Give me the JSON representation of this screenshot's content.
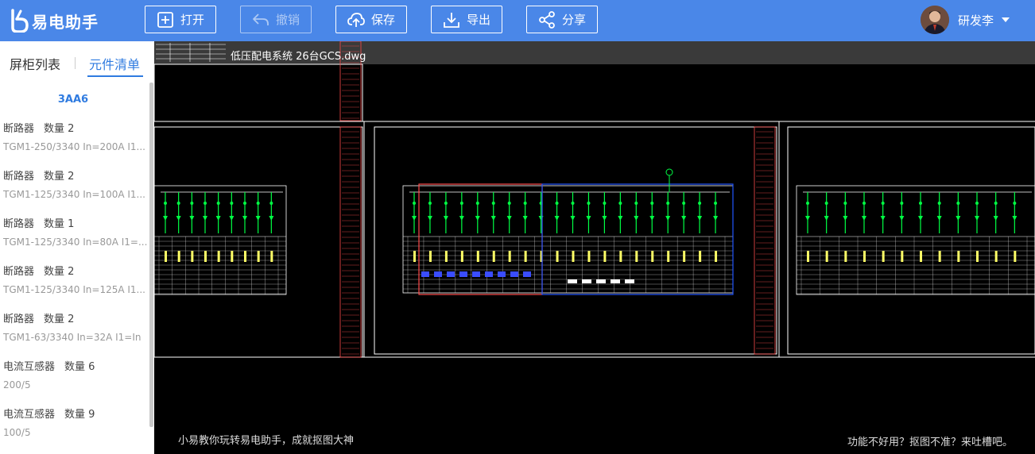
{
  "app": {
    "name": "易电助手"
  },
  "toolbar": {
    "open_label": "打开",
    "undo_label": "撤销",
    "save_label": "保存",
    "export_label": "导出",
    "share_label": "分享"
  },
  "user": {
    "name": "研发李"
  },
  "sidebar": {
    "tabs": [
      "屏柜列表",
      "元件清单"
    ],
    "active_tab": "元件清单",
    "group_title": "3AA6",
    "items": [
      {
        "name": "断路器",
        "qty": "数量  2",
        "spec": "TGM1-250/3340 In=200A I1..."
      },
      {
        "name": "断路器",
        "qty": "数量  2",
        "spec": "TGM1-125/3340 In=100A I1..."
      },
      {
        "name": "断路器",
        "qty": "数量  1",
        "spec": "TGM1-125/3340 In=80A I1=..."
      },
      {
        "name": "断路器",
        "qty": "数量  2",
        "spec": "TGM1-125/3340 In=125A I1..."
      },
      {
        "name": "断路器",
        "qty": "数量  2",
        "spec": "TGM1-63/3340 In=32A I1=In"
      },
      {
        "name": "电流互感器",
        "qty": "数量  6",
        "spec": "200/5"
      },
      {
        "name": "电流互感器",
        "qty": "数量  9",
        "spec": "100/5"
      }
    ]
  },
  "canvas": {
    "filename": "低压配电系统 26台GCS.dwg",
    "footer_left": "小易教你玩转易电助手，成就抠图大神",
    "footer_right": "功能不好用？抠图不准？来吐槽吧。"
  },
  "colors": {
    "topbar": "#4a87e8",
    "accent": "#2f7be0",
    "cad_red": "#ff4b4b",
    "cad_blue": "#2255ff",
    "cad_green": "#00ff44",
    "cad_white": "#ffffff"
  },
  "icons": {
    "logo": "yidian-logo-icon",
    "open": "file-plus-icon",
    "undo": "undo-arrow-icon",
    "save": "cloud-upload-icon",
    "export": "download-icon",
    "share": "share-icon"
  }
}
